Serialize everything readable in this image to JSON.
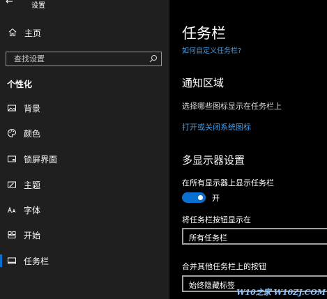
{
  "window": {
    "title": "设置"
  },
  "sidebar": {
    "home_label": "主页",
    "search_placeholder": "查找设置",
    "section_title": "个性化",
    "items": [
      {
        "label": "背景",
        "icon": "image-icon"
      },
      {
        "label": "颜色",
        "icon": "palette-icon"
      },
      {
        "label": "锁屏界面",
        "icon": "lock-screen-icon"
      },
      {
        "label": "主题",
        "icon": "theme-icon"
      },
      {
        "label": "字体",
        "icon": "font-icon"
      },
      {
        "label": "开始",
        "icon": "start-icon"
      },
      {
        "label": "任务栏",
        "icon": "taskbar-icon",
        "active": true
      }
    ]
  },
  "main": {
    "title": "任务栏",
    "customize_link": "如何自定义任务栏?",
    "notification": {
      "heading": "通知区域",
      "description": "选择哪些图标显示在任务栏上",
      "link": "打开或关闭系统图标"
    },
    "multi_display": {
      "heading": "多显示器设置",
      "show_all_label": "在所有显示器上显示任务栏",
      "toggle_state": "开",
      "buttons_label": "将任务栏按钮显示在",
      "buttons_value": "所有任务栏",
      "combine_label": "合并其他任务栏上的按钮",
      "combine_value": "始终隐藏标签"
    }
  },
  "watermark": "W10之家 W10ZJ.COM",
  "colors": {
    "accent": "#0a70d0",
    "link": "#3f9eeb",
    "sidebar_bg": "#1f1f1f",
    "main_bg": "#000000"
  }
}
